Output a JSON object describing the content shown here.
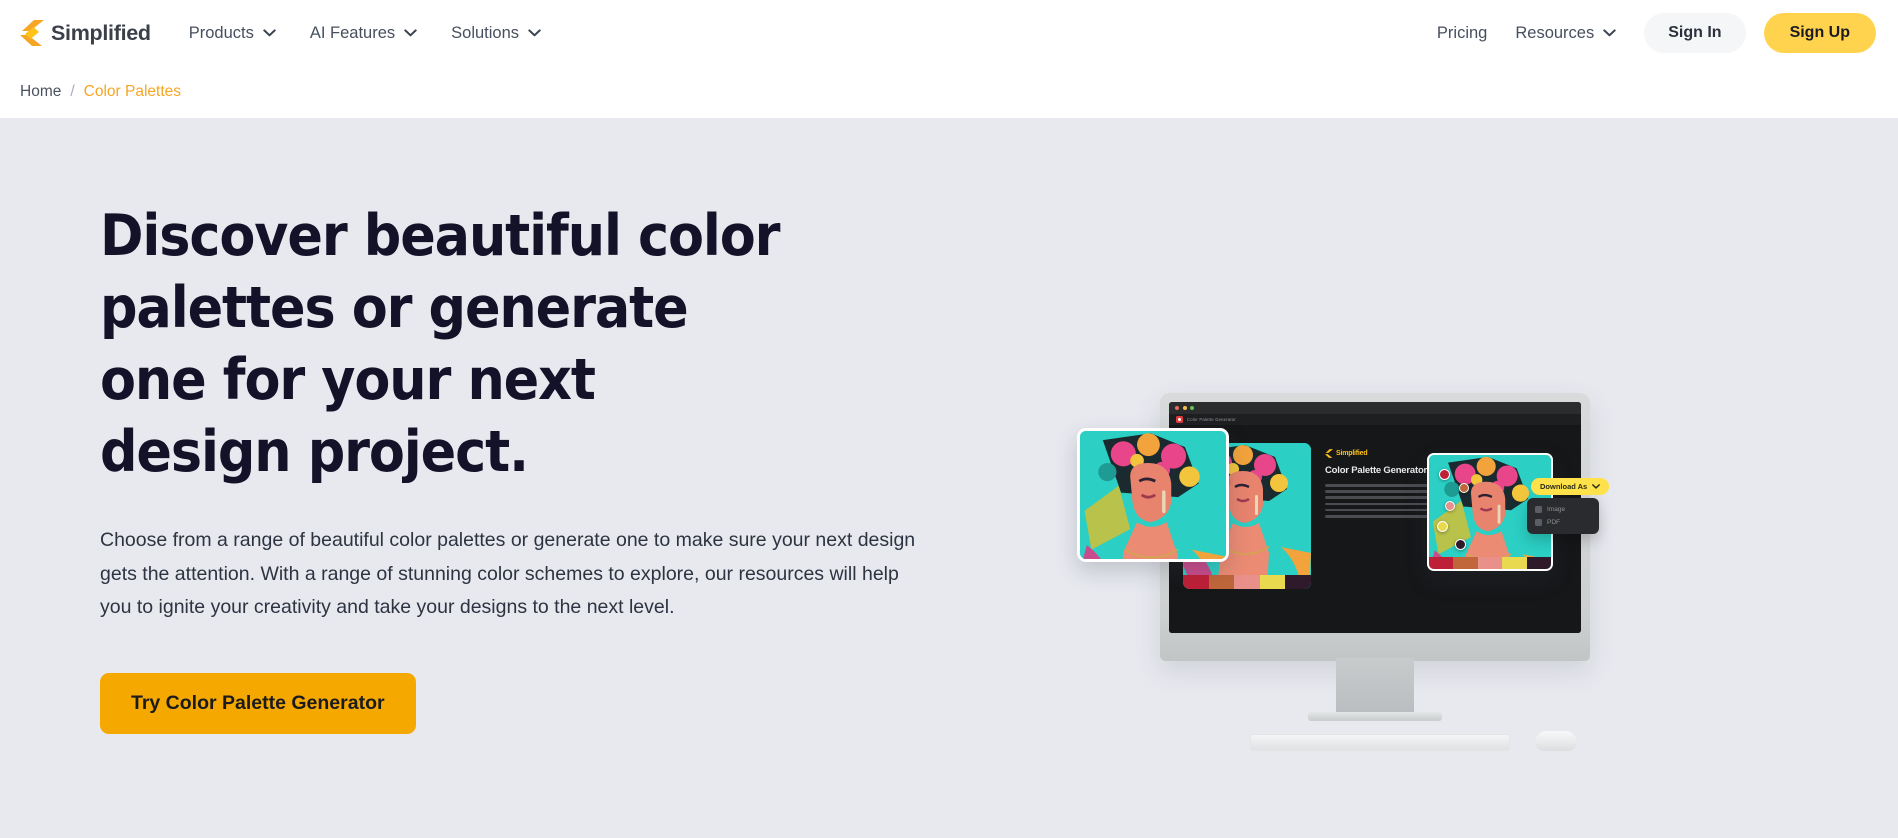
{
  "header": {
    "brand": {
      "name": "Simplified",
      "logo_icon": "simplified-bolt-logo",
      "color": "#F5A623"
    },
    "nav": [
      {
        "label": "Products",
        "icon": "chevron-down-icon",
        "has_dropdown": true
      },
      {
        "label": "AI Features",
        "icon": "chevron-down-icon",
        "has_dropdown": true
      },
      {
        "label": "Solutions",
        "icon": "chevron-down-icon",
        "has_dropdown": true
      }
    ],
    "right_nav": [
      {
        "label": "Pricing",
        "has_dropdown": false
      },
      {
        "label": "Resources",
        "icon": "chevron-down-icon",
        "has_dropdown": true
      }
    ],
    "sign_in_label": "Sign In",
    "sign_up_label": "Sign Up",
    "sign_up_color": "#FFD34E",
    "sign_in_bg": "#F5F6F8"
  },
  "breadcrumb": {
    "home_label": "Home",
    "separator": "/",
    "current_label": "Color Palettes",
    "current_color": "#F5A623"
  },
  "hero": {
    "background": "#E7E9EF",
    "title": "Discover beautiful color palettes or generate one for your next design project.",
    "title_color": "#141229",
    "subtitle": "Choose from a range of beautiful color palettes or generate one to make sure your next design gets the attention. With a range of stunning color schemes to explore, our resources will help you to ignite your creativity and take your designs to the next level.",
    "cta_label": "Try Color Palette Generator",
    "cta_color": "#F5A800"
  },
  "artwork": {
    "browser_tab_label": "Color Palette Generator",
    "app": {
      "brand_name": "Simplified",
      "title": "Color Palette Generator"
    },
    "download": {
      "button_label": "Download As",
      "button_color": "#FFE14A",
      "menu_items": [
        {
          "label": "Image",
          "icon": "image-icon"
        },
        {
          "label": "PDF",
          "icon": "pdf-icon"
        }
      ]
    },
    "palette": {
      "swatches": [
        "#BE2038",
        "#C0663A",
        "#E89089",
        "#E8D94F",
        "#2E1A2B"
      ],
      "artwork_background": "#2BCFC4"
    },
    "picker_colors": [
      "#BE2038",
      "#C0663A",
      "#E89089",
      "#E8D94F",
      "#2E1A2B"
    ],
    "devices": [
      "monitor",
      "keyboard",
      "mouse"
    ]
  }
}
